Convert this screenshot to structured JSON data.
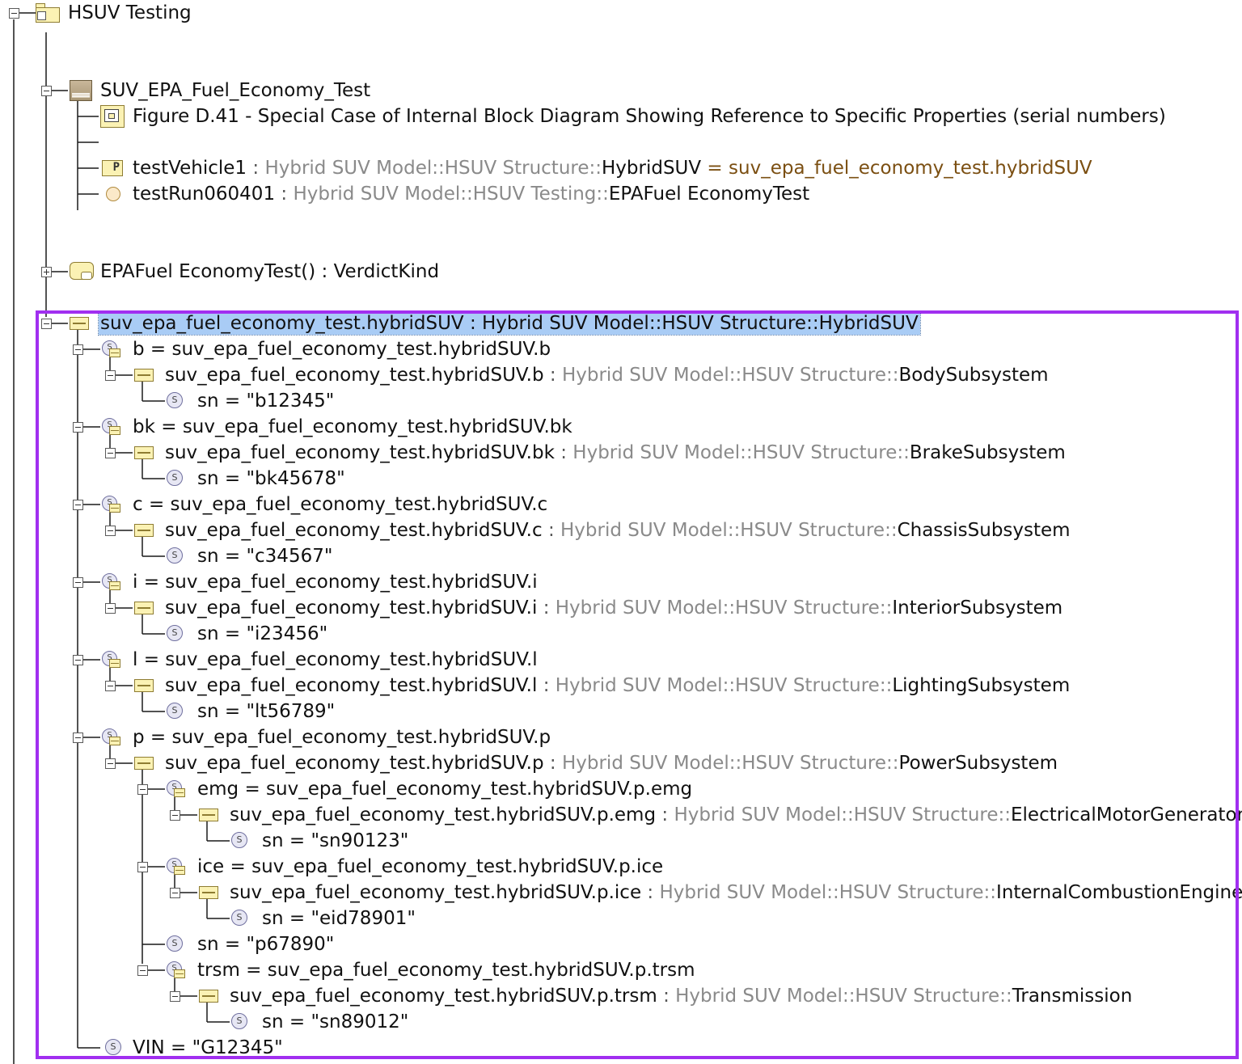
{
  "tree": {
    "root": {
      "label": "HSUV Testing"
    },
    "test_case": {
      "label": "SUV_EPA_Fuel_Economy_Test"
    },
    "diagram": {
      "label": "Figure D.41 - Special Case of Internal Block Diagram Showing Reference to Specific Properties (serial numbers)"
    },
    "test_vehicle": {
      "name": "testVehicle1",
      "sep": " : ",
      "type_path": "Hybrid SUV Model::HSUV Structure::",
      "type_name": "HybridSUV",
      "default_value": " = suv_epa_fuel_economy_test.hybridSUV"
    },
    "test_run": {
      "name": "testRun060401",
      "sep": " : ",
      "type_path": "Hybrid SUV Model::HSUV Testing::",
      "type_name": "EPAFuel EconomyTest"
    },
    "operation": {
      "label": "EPAFuel EconomyTest() : VerdictKind"
    },
    "instance": {
      "label": "suv_epa_fuel_economy_test.hybridSUV : Hybrid SUV Model::HSUV Structure::HybridSUV"
    },
    "slots": [
      {
        "slot": "b = suv_epa_fuel_economy_test.hybridSUV.b",
        "inst": "suv_epa_fuel_economy_test.hybridSUV.b",
        "sep": " : ",
        "type_path": "Hybrid SUV Model::HSUV Structure::",
        "type_name": "BodySubsystem",
        "sn": "sn = \"b12345\""
      },
      {
        "slot": "bk = suv_epa_fuel_economy_test.hybridSUV.bk",
        "inst": "suv_epa_fuel_economy_test.hybridSUV.bk",
        "sep": " : ",
        "type_path": "Hybrid SUV Model::HSUV Structure::",
        "type_name": "BrakeSubsystem",
        "sn": "sn = \"bk45678\""
      },
      {
        "slot": "c = suv_epa_fuel_economy_test.hybridSUV.c",
        "inst": "suv_epa_fuel_economy_test.hybridSUV.c",
        "sep": " : ",
        "type_path": "Hybrid SUV Model::HSUV Structure::",
        "type_name": "ChassisSubsystem",
        "sn": "sn = \"c34567\""
      },
      {
        "slot": "i = suv_epa_fuel_economy_test.hybridSUV.i",
        "inst": "suv_epa_fuel_economy_test.hybridSUV.i",
        "sep": " : ",
        "type_path": "Hybrid SUV Model::HSUV Structure::",
        "type_name": "InteriorSubsystem",
        "sn": "sn = \"i23456\""
      },
      {
        "slot": "l = suv_epa_fuel_economy_test.hybridSUV.l",
        "inst": "suv_epa_fuel_economy_test.hybridSUV.l",
        "sep": " : ",
        "type_path": "Hybrid SUV Model::HSUV Structure::",
        "type_name": "LightingSubsystem",
        "sn": "sn = \"lt56789\""
      }
    ],
    "power": {
      "slot": "p = suv_epa_fuel_economy_test.hybridSUV.p",
      "inst": "suv_epa_fuel_economy_test.hybridSUV.p",
      "sep": " : ",
      "type_path": "Hybrid SUV Model::HSUV Structure::",
      "type_name": "PowerSubsystem",
      "emg": {
        "slot": "emg = suv_epa_fuel_economy_test.hybridSUV.p.emg",
        "inst": "suv_epa_fuel_economy_test.hybridSUV.p.emg",
        "sep": " : ",
        "type_path": "Hybrid SUV Model::HSUV Structure::",
        "type_name": "ElectricalMotorGenerator",
        "sn": "sn = \"sn90123\""
      },
      "ice": {
        "slot": "ice = suv_epa_fuel_economy_test.hybridSUV.p.ice",
        "inst": "suv_epa_fuel_economy_test.hybridSUV.p.ice",
        "sep": " : ",
        "type_path": "Hybrid SUV Model::HSUV Structure::",
        "type_name": "InternalCombustionEngine",
        "sn": "sn = \"eid78901\""
      },
      "sn": "sn = \"p67890\"",
      "trsm": {
        "slot": "trsm = suv_epa_fuel_economy_test.hybridSUV.p.trsm",
        "inst": "suv_epa_fuel_economy_test.hybridSUV.p.trsm",
        "sep": " : ",
        "type_path": "Hybrid SUV Model::HSUV Structure::",
        "type_name": "Transmission",
        "sn": "sn = \"sn89012\""
      }
    },
    "vin": "VIN = \"G12345\""
  },
  "colors": {
    "highlight_frame": "#a12ff0",
    "selection": "#a9ccf5",
    "type_path": "#8a8a8a",
    "default_value": "#7b4f12"
  }
}
